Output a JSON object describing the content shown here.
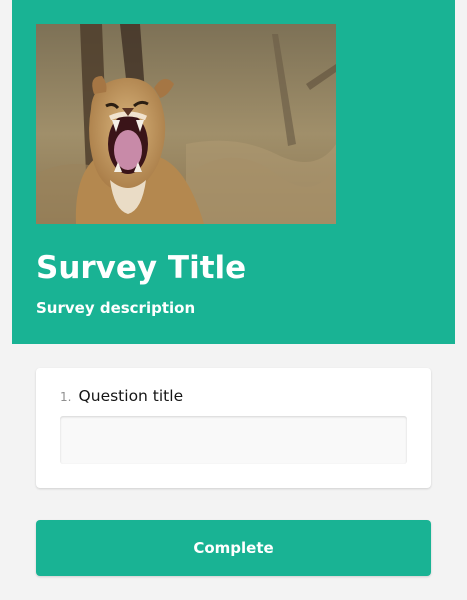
{
  "header": {
    "title": "Survey Title",
    "description": "Survey description",
    "logo_icon": "lioness-roaring-image",
    "background_color": "#19b394"
  },
  "question": {
    "number": "1.",
    "title": "Question title",
    "value": ""
  },
  "footer": {
    "complete_label": "Complete"
  },
  "colors": {
    "accent": "#19b394",
    "page_background": "#f3f3f3"
  }
}
